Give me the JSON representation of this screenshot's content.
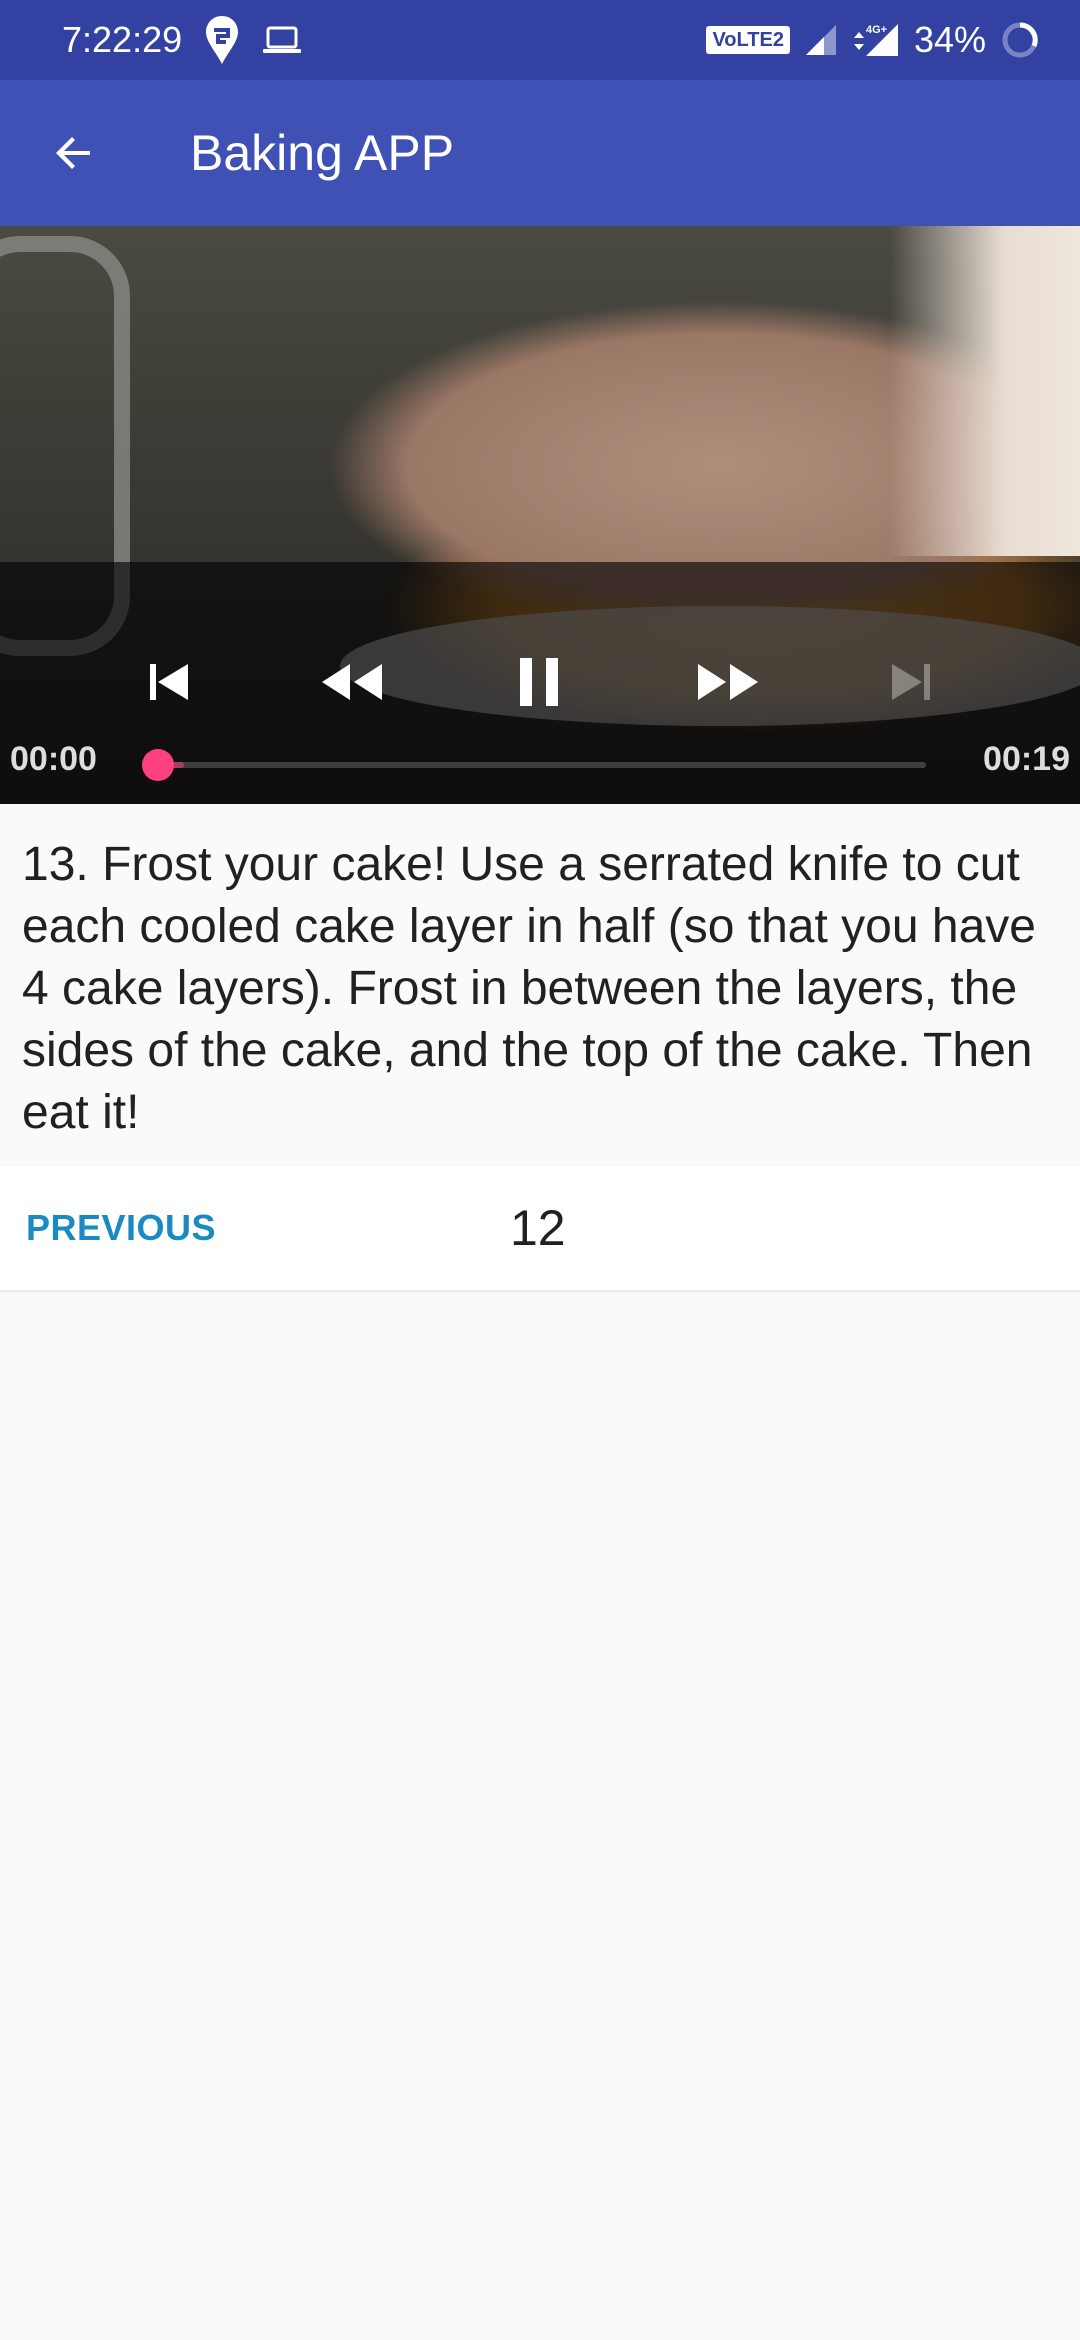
{
  "status_bar": {
    "time": "7:22:29",
    "volte_label": "VoLTE2",
    "network_label": "4G+",
    "battery": "34%",
    "icons": [
      "swiggy-icon",
      "laptop-icon",
      "signal-icon",
      "signal-4g-icon",
      "battery-ring-icon"
    ]
  },
  "app_bar": {
    "title": "Baking APP",
    "back_icon": "arrow-back-icon"
  },
  "player": {
    "position": "00:00",
    "duration": "00:19",
    "progress_fraction": 0.0,
    "state": "playing",
    "controls": [
      "skip-previous-icon",
      "rewind-icon",
      "pause-icon",
      "fast-forward-icon",
      "skip-next-icon"
    ],
    "accent_color": "#ff4081"
  },
  "step": {
    "description": "13. Frost your cake! Use a serrated knife to cut each cooled cake layer in half (so that you have 4 cake layers). Frost in between the layers, the sides of the cake, and the top of the cake. Then eat it!"
  },
  "navigation": {
    "previous_label": "PREVIOUS",
    "step_number": "12"
  },
  "colors": {
    "status_bar": "#3341a3",
    "app_bar": "#3f51b5",
    "link": "#1a8ac3"
  }
}
